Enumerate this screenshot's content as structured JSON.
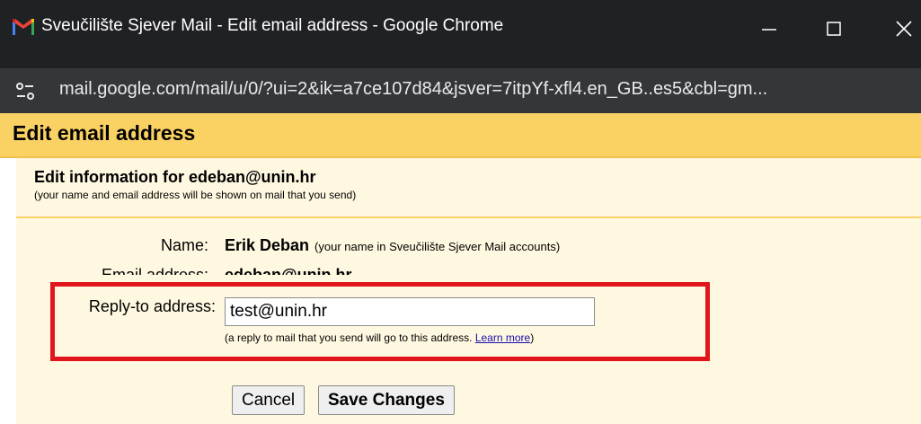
{
  "window": {
    "title": "Sveučilište Sjever Mail - Edit email address - Google Chrome",
    "app_icon": "gmail-icon",
    "controls": [
      "minimize-icon",
      "maximize-icon",
      "close-icon"
    ]
  },
  "address_bar": {
    "url": "mail.google.com/mail/u/0/?ui=2&ik=a7ce107d84&jsver=7itpYf-xfl4.en_GB..es5&cbl=gm...",
    "site_info_icon": "tune-icon"
  },
  "dialog": {
    "title": "Edit email address",
    "section_title": "Edit information for edeban@unin.hr",
    "section_subtitle": "(your name and email address will be shown on mail that you send)",
    "name": {
      "label": "Name:",
      "value": "Erik Deban",
      "hint": "(your name in Sveučilište Sjever Mail accounts)"
    },
    "email": {
      "label": "Email address:",
      "value": "edeban@unin.hr"
    },
    "reply_to": {
      "label": "Reply-to address:",
      "value": "test@unin.hr",
      "hint_before": "(a reply to mail that you send will go to this address. ",
      "learn_more": "Learn more",
      "hint_after": ")"
    },
    "buttons": {
      "cancel": "Cancel",
      "save": "Save Changes"
    }
  },
  "colors": {
    "titlebar": "#202124",
    "urlbar": "#35363a",
    "header": "#fad163",
    "content": "#fff8e1",
    "highlight": "#e1161c",
    "link": "#1a0dab"
  }
}
